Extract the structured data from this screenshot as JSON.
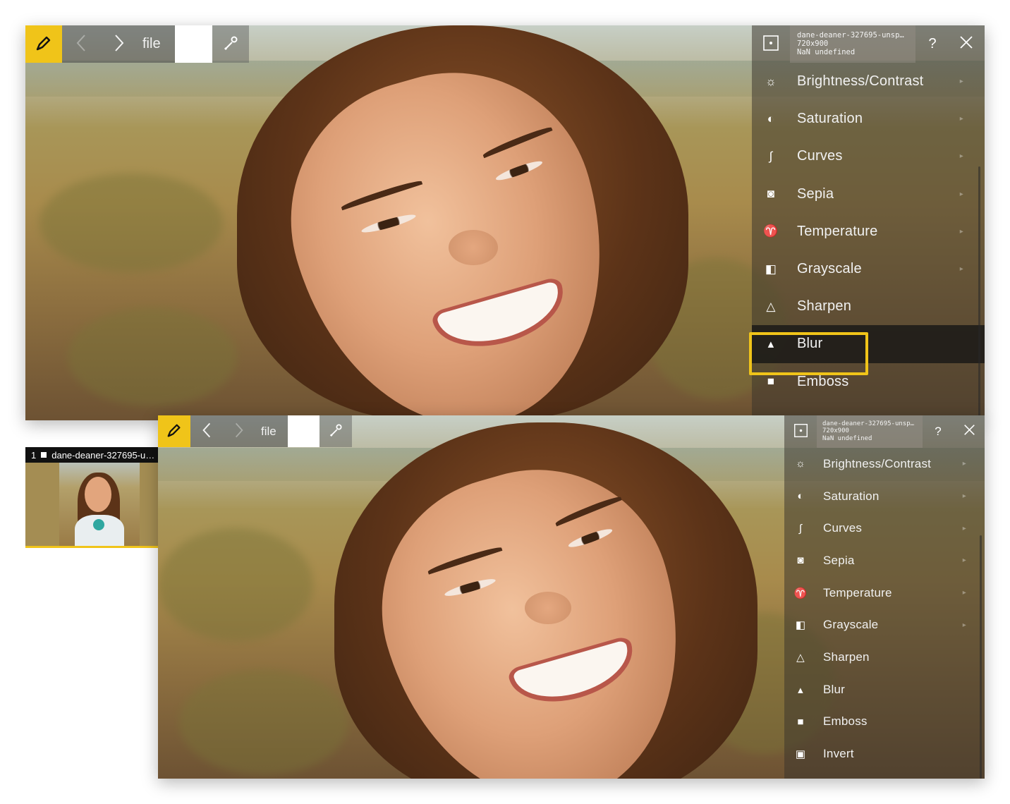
{
  "toolbar": {
    "brush_icon": "brush-icon",
    "back_icon": "chevron-left-icon",
    "forward_icon": "chevron-right-icon",
    "file_label": "file",
    "dropper_icon": "eyedropper-icon"
  },
  "file_info": {
    "name": "dane-deaner-327695-unsp…",
    "dimensions": "720x900",
    "extra": "NaN undefined"
  },
  "panel": {
    "fit_icon": "fit-screen-icon",
    "help_label": "?",
    "close_icon": "close-icon"
  },
  "menu_top": [
    {
      "label": "Brightness/Contrast",
      "icon": "sun-icon",
      "glyph": "☼"
    },
    {
      "label": "Saturation",
      "icon": "saturation-icon",
      "glyph": "◐"
    },
    {
      "label": "Curves",
      "icon": "curves-icon",
      "glyph": "∫"
    },
    {
      "label": "Sepia",
      "icon": "sepia-icon",
      "glyph": "◙"
    },
    {
      "label": "Temperature",
      "icon": "thermometer-icon",
      "glyph": "♈"
    },
    {
      "label": "Grayscale",
      "icon": "grayscale-icon",
      "glyph": "◧"
    },
    {
      "label": "Sharpen",
      "icon": "triangle-icon",
      "glyph": "△"
    },
    {
      "label": "Blur",
      "icon": "drop-icon",
      "glyph": "▴"
    },
    {
      "label": "Emboss",
      "icon": "emboss-icon",
      "glyph": "■"
    }
  ],
  "menu_bottom": [
    {
      "label": "Brightness/Contrast",
      "icon": "sun-icon",
      "glyph": "☼"
    },
    {
      "label": "Saturation",
      "icon": "saturation-icon",
      "glyph": "◐"
    },
    {
      "label": "Curves",
      "icon": "curves-icon",
      "glyph": "∫"
    },
    {
      "label": "Sepia",
      "icon": "sepia-icon",
      "glyph": "◙"
    },
    {
      "label": "Temperature",
      "icon": "thermometer-icon",
      "glyph": "♈"
    },
    {
      "label": "Grayscale",
      "icon": "grayscale-icon",
      "glyph": "◧"
    },
    {
      "label": "Sharpen",
      "icon": "triangle-icon",
      "glyph": "△"
    },
    {
      "label": "Blur",
      "icon": "drop-icon",
      "glyph": "▴"
    },
    {
      "label": "Emboss",
      "icon": "emboss-icon",
      "glyph": "■"
    },
    {
      "label": "Invert",
      "icon": "invert-icon",
      "glyph": "▣"
    }
  ],
  "active_item": "Blur",
  "thumbnail": {
    "index": "1",
    "name": "dane-deaner-327695-u…"
  },
  "colors": {
    "accent": "#f0c419",
    "panel_bg": "rgba(58,52,44,0.52)",
    "active_bg": "#1a1a1a"
  }
}
